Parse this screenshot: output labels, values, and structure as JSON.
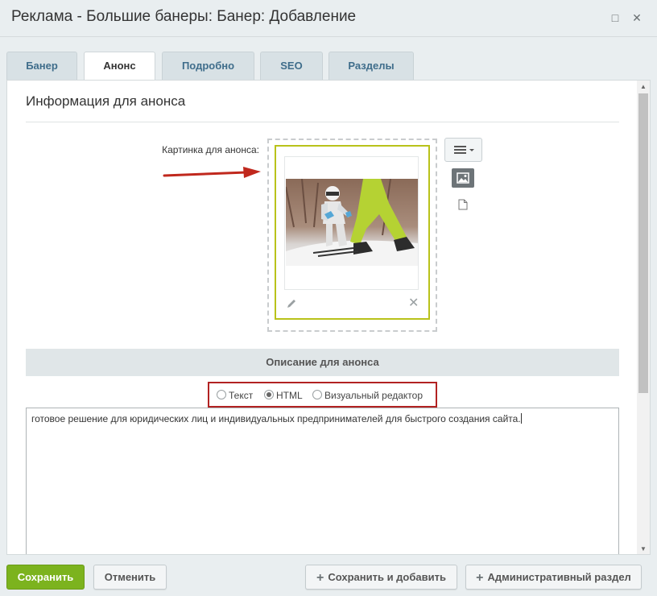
{
  "window": {
    "title": "Реклама - Большие банеры: Банер: Добавление",
    "maximize_icon": "□",
    "close_icon": "✕"
  },
  "tabs": [
    {
      "label": "Банер",
      "active": false
    },
    {
      "label": "Анонс",
      "active": true
    },
    {
      "label": "Подробно",
      "active": false
    },
    {
      "label": "SEO",
      "active": false
    },
    {
      "label": "Разделы",
      "active": false
    }
  ],
  "section": {
    "title": "Информация для анонса",
    "picture_label": "Картинка для анонса:",
    "remove_icon": "✕"
  },
  "description": {
    "header": "Описание для анонса",
    "modes": [
      {
        "label": "Текст",
        "checked": false
      },
      {
        "label": "HTML",
        "checked": true
      },
      {
        "label": "Визуальный редактор",
        "checked": false
      }
    ],
    "text": "готовое решение для юридических лиц и индивидуальных предпринимателей для быстрого создания сайта."
  },
  "footer": {
    "save_label": "Сохранить",
    "cancel_label": "Отменить",
    "save_add_label": "Сохранить и добавить",
    "admin_section_label": "Административный раздел"
  },
  "colors": {
    "accent_green": "#7cb31e",
    "tab_text": "#3f6d8b",
    "highlight_red": "#b22222",
    "preview_border": "#b9c21a"
  }
}
